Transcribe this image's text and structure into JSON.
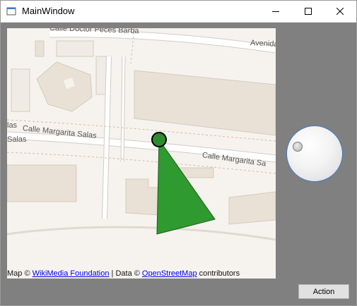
{
  "window": {
    "title": "MainWindow"
  },
  "map": {
    "street_labels": {
      "top": "Calle Doctor Peces Barba",
      "top_right": "Avenida",
      "left_upper": "las",
      "middle": "Calle Margarita Salas",
      "left_lower": "Salas",
      "right": "Calle Margarita Sa"
    },
    "attribution": {
      "prefix": "Map ©",
      "link1": "WikiMedia Foundation",
      "middle": "| Data ©",
      "link2": "OpenStreetMap",
      "suffix": "contributors"
    },
    "marker_color": "#2e8b2e",
    "cone_color": "#2f9a2f"
  },
  "controls": {
    "action_label": "Action"
  }
}
